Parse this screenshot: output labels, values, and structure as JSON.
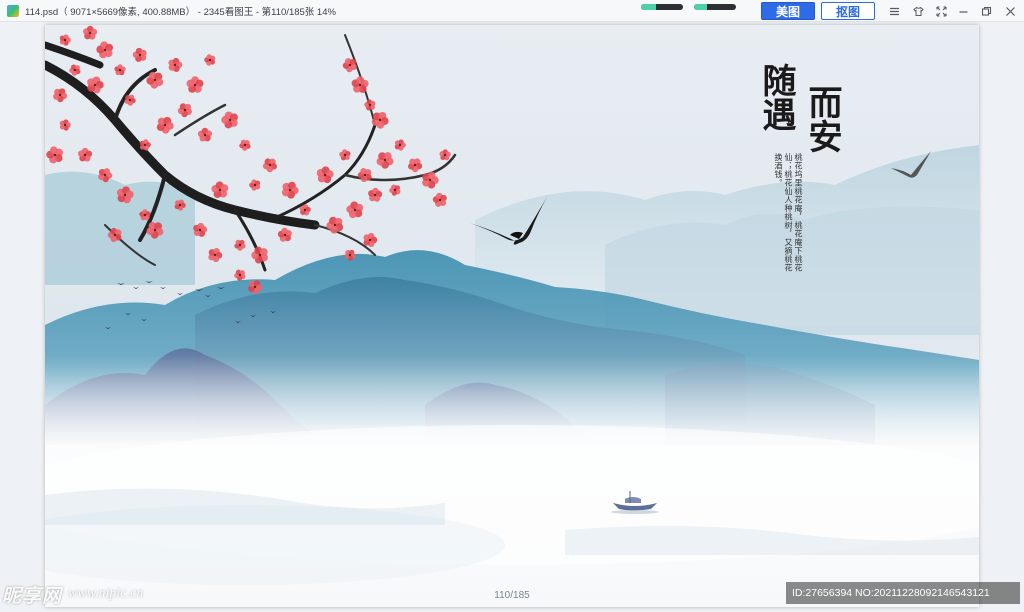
{
  "window": {
    "title": "114.psd（ 9071×5669像素, 400.88MB） - 2345看图王 - 第110/185张 14%",
    "toggle1_progress": 0.35,
    "toggle2_progress": 0.3
  },
  "toolbar": {
    "beautify_label": "美图",
    "cutout_label": "抠图"
  },
  "icons": {
    "menu": "menu-icon",
    "skin": "shirt-icon",
    "fullscreen": "fullscreen-icon",
    "minimize": "minimize-icon",
    "restore": "restore-icon",
    "close": "close-icon"
  },
  "artwork": {
    "title_line1": "随遇",
    "title_line2": "而安",
    "poem": "桃花坞里桃花庵，桃花庵下桃花仙；桃花仙人种桃树，又摘桃花换酒钱。"
  },
  "viewer": {
    "page_counter": "110/185"
  },
  "watermark": {
    "logo": "昵享网",
    "url": "www.nipic.cn",
    "id_text": "ID:27656394 NO:20211228092146543121"
  }
}
